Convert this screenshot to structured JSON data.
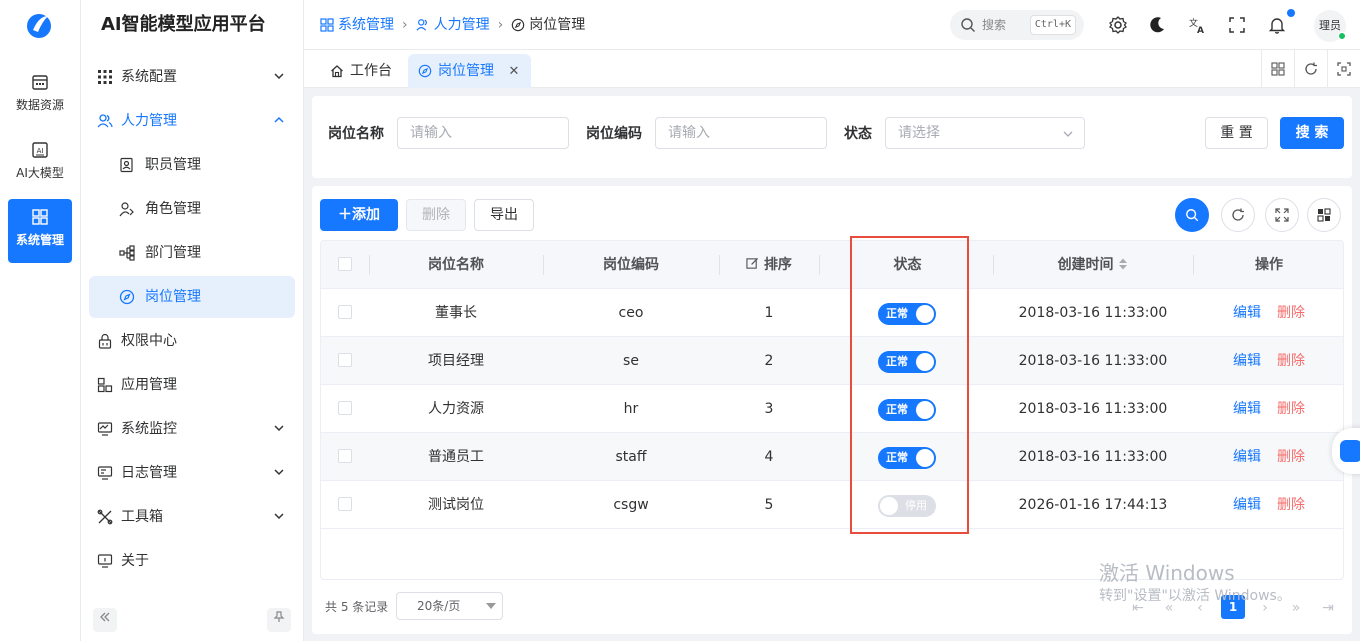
{
  "app": {
    "title": "AI智能模型应用平台"
  },
  "rail": {
    "items": [
      {
        "label": "数据资源",
        "icon": "calendar-icon"
      },
      {
        "label": "AI大模型",
        "icon": "ai-chip-icon"
      },
      {
        "label": "系统管理",
        "icon": "system-grid-icon",
        "active": true
      }
    ]
  },
  "menu": {
    "items": [
      {
        "label": "系统配置",
        "icon": "grid-dots-icon"
      },
      {
        "label": "人力管理",
        "icon": "users-icon"
      },
      {
        "label": "职员管理",
        "icon": "user-id-icon"
      },
      {
        "label": "角色管理",
        "icon": "user-role-icon"
      },
      {
        "label": "部门管理",
        "icon": "org-tree-icon"
      },
      {
        "label": "岗位管理",
        "icon": "compass-icon"
      },
      {
        "label": "权限中心",
        "icon": "lock-icon"
      },
      {
        "label": "应用管理",
        "icon": "apps-icon"
      },
      {
        "label": "系统监控",
        "icon": "monitor-icon"
      },
      {
        "label": "日志管理",
        "icon": "log-monitor-icon"
      },
      {
        "label": "工具箱",
        "icon": "tools-icon"
      },
      {
        "label": "关于",
        "icon": "about-icon"
      }
    ]
  },
  "header": {
    "breadcrumb": [
      "系统管理",
      "人力管理",
      "岗位管理"
    ],
    "search": {
      "placeholder": "搜索",
      "shortcut": "Ctrl+K"
    },
    "user": "理员"
  },
  "tabs": [
    {
      "label": "工作台",
      "icon": "home-icon"
    },
    {
      "label": "岗位管理",
      "icon": "compass-icon",
      "active": true
    }
  ],
  "filter": {
    "name_label": "岗位名称",
    "name_placeholder": "请输入",
    "code_label": "岗位编码",
    "code_placeholder": "请输入",
    "status_label": "状态",
    "status_placeholder": "请选择",
    "reset": "重 置",
    "search": "搜 索"
  },
  "toolbar": {
    "add": "添加",
    "delete": "删除",
    "export": "导出"
  },
  "table": {
    "headers": {
      "name": "岗位名称",
      "code": "岗位编码",
      "sort": "排序",
      "status": "状态",
      "created": "创建时间",
      "ops": "操作"
    },
    "rows": [
      {
        "name": "董事长",
        "code": "ceo",
        "sort": "1",
        "status": "正常",
        "enabled": true,
        "created": "2018-03-16 11:33:00"
      },
      {
        "name": "项目经理",
        "code": "se",
        "sort": "2",
        "status": "正常",
        "enabled": true,
        "created": "2018-03-16 11:33:00"
      },
      {
        "name": "人力资源",
        "code": "hr",
        "sort": "3",
        "status": "正常",
        "enabled": true,
        "created": "2018-03-16 11:33:00"
      },
      {
        "name": "普通员工",
        "code": "staff",
        "sort": "4",
        "status": "正常",
        "enabled": true,
        "created": "2018-03-16 11:33:00"
      },
      {
        "name": "测试岗位",
        "code": "csgw",
        "sort": "5",
        "status": "停用",
        "enabled": false,
        "created": "2026-01-16 17:44:13"
      }
    ],
    "edit": "编辑",
    "delete": "删除"
  },
  "pager": {
    "total": "共 5 条记录",
    "size": "20条/页",
    "current": "1"
  },
  "watermark": {
    "line1": "激活 Windows",
    "line2": "转到\"设置\"以激活 Windows。"
  },
  "colors": {
    "primary": "#1677ff",
    "danger": "#f56c6c",
    "highlight": "#e74c3c"
  }
}
